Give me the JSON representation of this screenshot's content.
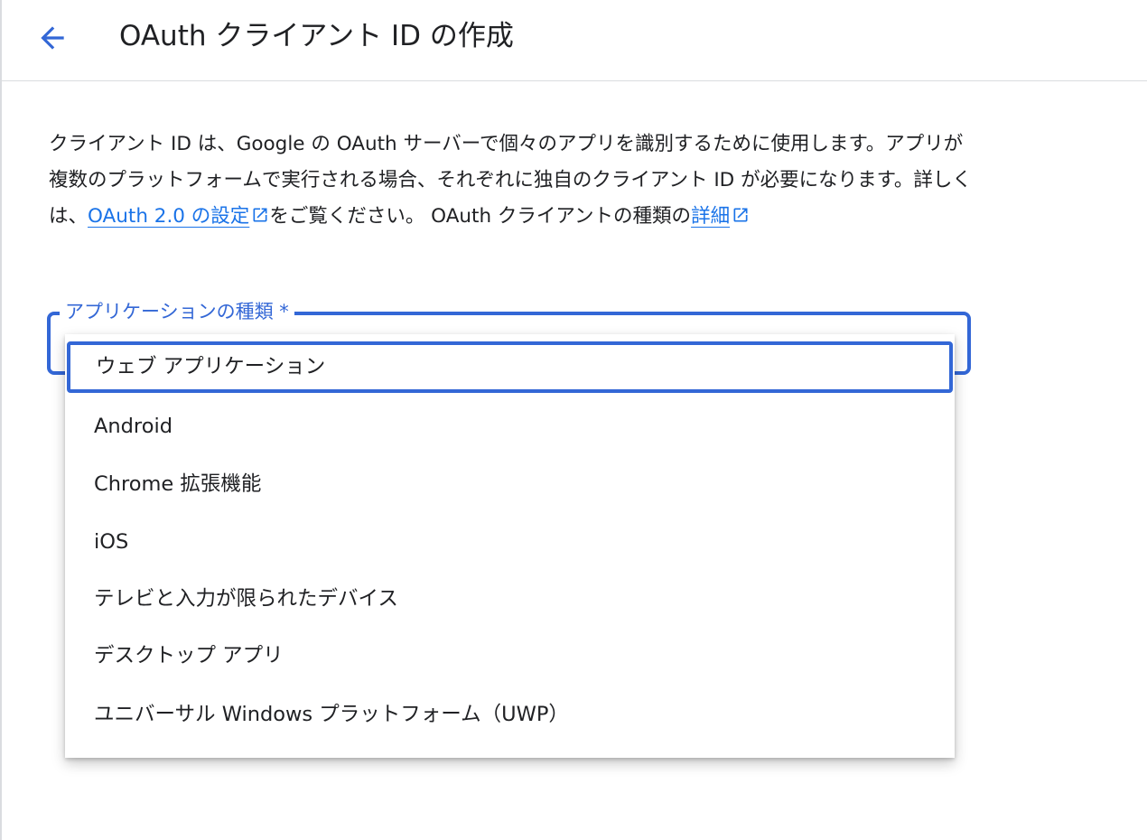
{
  "header": {
    "back_icon": "arrow-back-icon",
    "title": "OAuth クライアント ID の作成"
  },
  "description": {
    "text_part1": "クライアント ID は、Google の OAuth サーバーで個々のアプリを識別するために使用します。アプリが複数のプラットフォームで実行される場合、それぞれに独自のクライアント ID が必要になります。詳しくは、",
    "link1_text": "OAuth 2.0 の設定",
    "text_part2": "をご覧ください。 OAuth クライアントの種類の",
    "link2_text": "詳細",
    "link_icon": "open-in-new-icon"
  },
  "application_type": {
    "label": "アプリケーションの種類 *",
    "options": [
      "ウェブ アプリケーション",
      "Android",
      "Chrome 拡張機能",
      "iOS",
      "テレビと入力が限られたデバイス",
      "デスクトップ アプリ",
      "ユニバーサル Windows プラットフォーム（UWP）"
    ],
    "focused_option": "ウェブ アプリケーション"
  },
  "colors": {
    "accent": "#3367d6",
    "link": "#1a73e8",
    "text": "#202124",
    "divider": "#dadce0"
  }
}
